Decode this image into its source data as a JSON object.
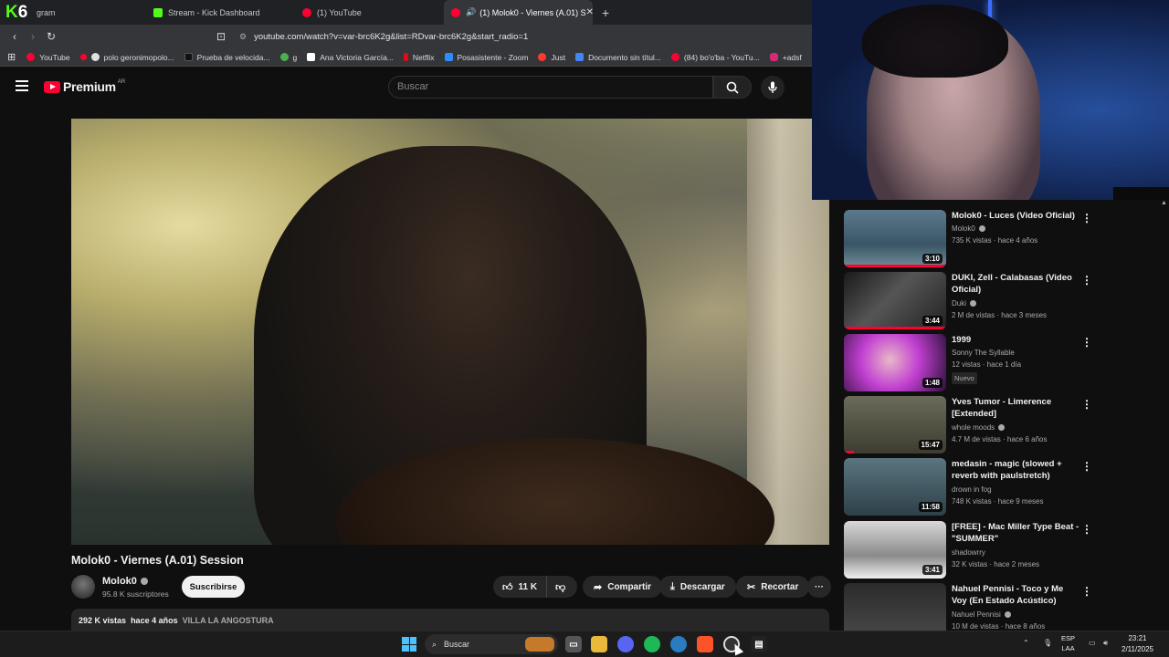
{
  "browser": {
    "tabs": [
      {
        "label": "gram",
        "color": "#53fc18"
      },
      {
        "label": "Stream - Kick Dashboard",
        "color": "#53fc18"
      },
      {
        "label": "(1) YouTube",
        "color": "#ff0033"
      },
      {
        "label": "(1) Molok0 - Viernes (A.01) S",
        "color": "#ff0033",
        "active": true
      }
    ],
    "kick_logo": "K",
    "kick_count": "6",
    "url": "youtube.com/watch?v=var-brc6K2g&list=RDvar-brc6K2g&start_radio=1",
    "bookmarks": [
      {
        "label": "YouTube",
        "color": "#ff0033"
      },
      {
        "label": "polo geronimopolo...",
        "color": "#e0e0e0"
      },
      {
        "label": "Prueba de velocida...",
        "color": "#222222"
      },
      {
        "label": "g",
        "color": "#4caf50"
      },
      {
        "label": "Ana Victoria García...",
        "color": "#ffffff"
      },
      {
        "label": "Netflix",
        "color": "#e50914"
      },
      {
        "label": "Posasistente - Zoom",
        "color": "#2d8cff"
      },
      {
        "label": "Just",
        "color": "#ff3b30"
      },
      {
        "label": "Documento sin títul...",
        "color": "#4285f4"
      },
      {
        "label": "(84) bo'o'ba - YouTu...",
        "color": "#ff0033"
      },
      {
        "label": "+adsf",
        "color": "#d62976"
      }
    ]
  },
  "yt": {
    "logo_text": "Premium",
    "logo_region": "AR",
    "search_placeholder": "Buscar"
  },
  "video": {
    "title": "Molok0 - Viernes (A.01) Session",
    "channel": "Molok0",
    "subscribers": "95.8 K suscriptores",
    "subscribe_label": "Suscribirse",
    "likes": "11 K",
    "share_label": "Compartir",
    "download_label": "Descargar",
    "clip_label": "Recortar",
    "views": "292 K vistas",
    "age": "hace 4 años",
    "location": "VILLA LA ANGOSTURA"
  },
  "sidebar": [
    {
      "title": "Molok0 - Luces (Video Oficial)",
      "channel": "Molok0",
      "verified": true,
      "meta": "735 K vistas · hace 4 años",
      "duration": "3:10",
      "progress": 1.0,
      "badge": ""
    },
    {
      "title": "DUKI, Zell - Calabasas (Video Oficial)",
      "channel": "Duki",
      "verified": true,
      "meta": "2 M de vistas · hace 3 meses",
      "duration": "3:44",
      "progress": 1.0,
      "badge": ""
    },
    {
      "title": "1999",
      "channel": "Sonny The Syllable",
      "verified": false,
      "meta": "12 vistas · hace 1 día",
      "duration": "1:48",
      "progress": 0,
      "badge": "Nuevo"
    },
    {
      "title": "Yves Tumor - Limerence [Extended]",
      "channel": "whole moods",
      "verified": true,
      "meta": "4.7 M de vistas · hace 6 años",
      "duration": "15:47",
      "progress": 0.1,
      "badge": ""
    },
    {
      "title": "medasin - magic (slowed + reverb with paulstretch)",
      "channel": "drown in fog",
      "verified": false,
      "meta": "748 K vistas · hace 9 meses",
      "duration": "11:58",
      "progress": 0,
      "badge": ""
    },
    {
      "title": "[FREE]  - Mac Miller Type Beat - \"SUMMER\"",
      "channel": "shadowrry",
      "verified": false,
      "meta": "32 K vistas · hace 2 meses",
      "duration": "3:41",
      "progress": 0,
      "badge": ""
    },
    {
      "title": "Nahuel Pennisi - Toco y Me Voy (En Estado Acústico)",
      "channel": "Nahuel Pennisi",
      "verified": true,
      "meta": "10 M de vistas · hace 8 años",
      "duration": "",
      "progress": 0,
      "badge": ""
    }
  ],
  "taskbar": {
    "search_label": "Buscar",
    "lang_top": "ESP",
    "lang_bottom": "LAA",
    "time": "23:21",
    "date": "2/11/2025"
  }
}
